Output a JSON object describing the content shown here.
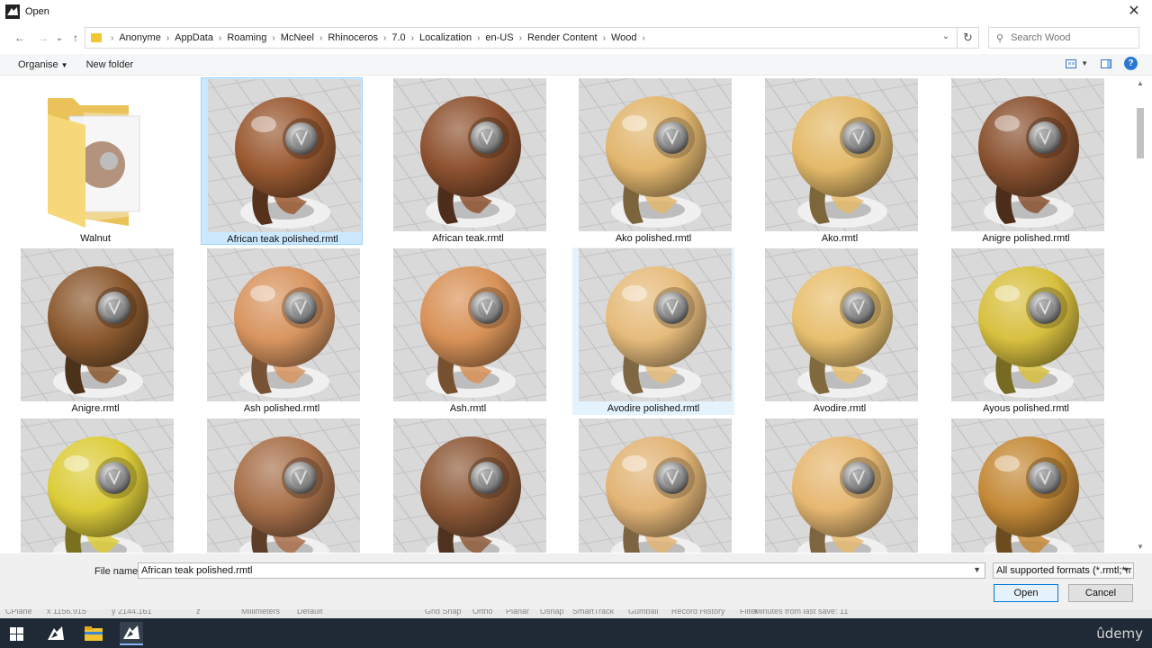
{
  "window": {
    "title": "Open",
    "close_glyph": "✕"
  },
  "nav": {
    "back_glyph": "←",
    "forward_glyph": "→",
    "recent_glyph": "⌄",
    "up_glyph": "↑",
    "breadcrumb": [
      "Anonyme",
      "AppData",
      "Roaming",
      "McNeel",
      "Rhinoceros",
      "7.0",
      "Localization",
      "en-US",
      "Render Content",
      "Wood"
    ],
    "refresh_glyph": "↻",
    "search_placeholder": "Search Wood"
  },
  "toolbar": {
    "organise_label": "Organise",
    "new_folder_label": "New folder",
    "help_glyph": "?"
  },
  "items": [
    {
      "name": "Walnut",
      "kind": "folder",
      "color": "#8a5a3a"
    },
    {
      "name": "African teak polished.rmtl",
      "kind": "material",
      "color": "#9a5a32",
      "gloss": true,
      "selected": true
    },
    {
      "name": "African teak.rmtl",
      "kind": "material",
      "color": "#8e5230",
      "gloss": false
    },
    {
      "name": "Ako polished.rmtl",
      "kind": "material",
      "color": "#e2b66e",
      "gloss": true
    },
    {
      "name": "Ako.rmtl",
      "kind": "material",
      "color": "#e4ba6a",
      "gloss": false
    },
    {
      "name": "Anigre polished.rmtl",
      "kind": "material",
      "color": "#8a5230",
      "gloss": true
    },
    {
      "name": "Anigre.rmtl",
      "kind": "material",
      "color": "#8c5a30",
      "gloss": false
    },
    {
      "name": "Ash polished.rmtl",
      "kind": "material",
      "color": "#d89560",
      "gloss": true
    },
    {
      "name": "Ash.rmtl",
      "kind": "material",
      "color": "#d89258",
      "gloss": false
    },
    {
      "name": "Avodire polished.rmtl",
      "kind": "material",
      "color": "#e6bc7c",
      "gloss": true,
      "hover": true
    },
    {
      "name": "Avodire.rmtl",
      "kind": "material",
      "color": "#e8c070",
      "gloss": false
    },
    {
      "name": "Ayous polished.rmtl",
      "kind": "material",
      "color": "#d8c040",
      "gloss": true
    },
    {
      "name": "",
      "kind": "material",
      "color": "#dccc3a",
      "gloss": true
    },
    {
      "name": "",
      "kind": "material",
      "color": "#a8704a",
      "gloss": false
    },
    {
      "name": "",
      "kind": "material",
      "color": "#8e5a38",
      "gloss": false
    },
    {
      "name": "",
      "kind": "material",
      "color": "#e2b476",
      "gloss": true
    },
    {
      "name": "",
      "kind": "material",
      "color": "#e6b872",
      "gloss": false
    },
    {
      "name": "",
      "kind": "material",
      "color": "#c48a38",
      "gloss": true
    }
  ],
  "bottom": {
    "file_name_label": "File name:",
    "file_name_value": "African teak polished.rmtl",
    "filter_value": "All supported formats (*.rmtl;*.r",
    "open_label": "Open",
    "cancel_label": "Cancel"
  },
  "statusbar": {
    "items": [
      "CPlane",
      "x 1156.915",
      "y 2144.161",
      "z",
      "Millimeters",
      "Default",
      "Grid Snap",
      "Ortho",
      "Planar",
      "Osnap",
      "SmartTrack",
      "Gumball",
      "Record History",
      "Filter",
      "Minutes from last save: 11"
    ]
  },
  "taskbar": {
    "watermark": "ûdemy"
  }
}
